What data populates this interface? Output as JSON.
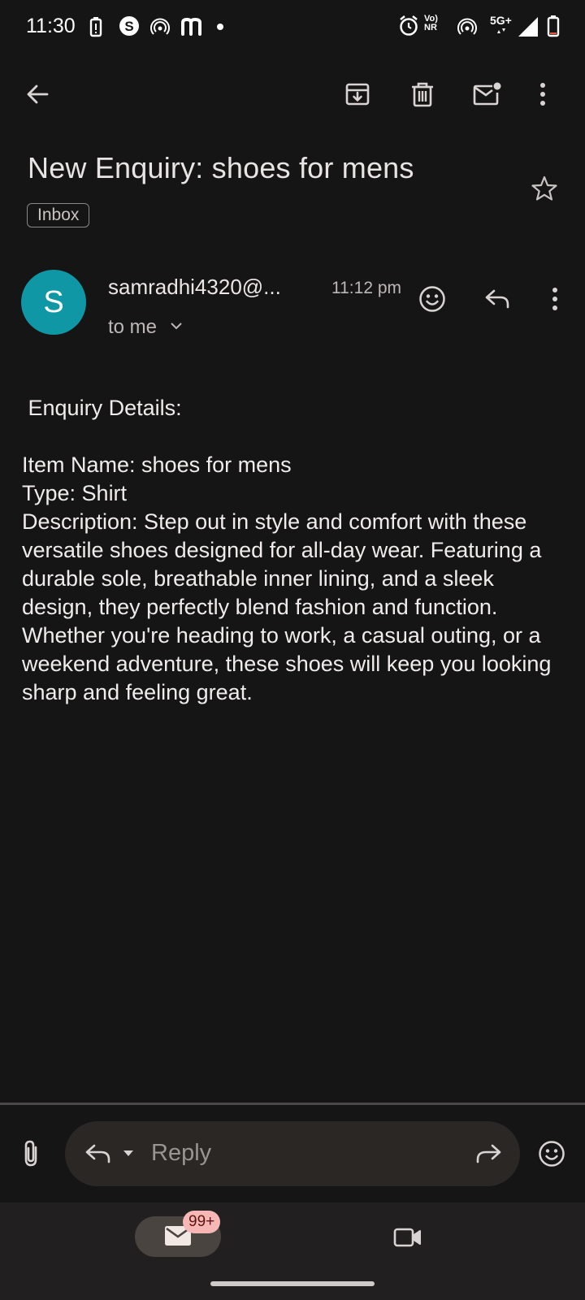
{
  "status_bar": {
    "time": "11:30",
    "left_icons": [
      "battery-saver-icon",
      "s-app-icon",
      "hotspot-icon",
      "m-app-icon",
      "dot-icon"
    ],
    "right_icons": [
      "alarm-icon",
      "vonr-icon",
      "hotspot-icon",
      "signal-icon",
      "battery-icon"
    ],
    "vo_label": "Vo",
    "nr_label": "NR",
    "network_label": "5G+"
  },
  "toolbar": {
    "back": "back-arrow-icon",
    "archive": "archive-icon",
    "delete": "delete-icon",
    "mark_unread": "mark-unread-icon",
    "more": "more-vert-icon"
  },
  "email": {
    "subject": "New Enquiry: shoes for mens",
    "label": "Inbox",
    "sender": {
      "initial": "S",
      "name": "samradhi4320@...",
      "time": "11:12 pm",
      "recipient": "to me"
    },
    "body": " Enquiry Details:\n\nItem Name: shoes for mens\nType: Shirt\nDescription: Step out in style and comfort with these versatile shoes designed for all-day wear. Featuring a durable sole, breathable inner lining, and a sleek design, they perfectly blend fashion and function. Whether you're heading to work, a casual outing, or a weekend adventure, these shoes will keep you looking sharp and feeling great."
  },
  "reply_bar": {
    "placeholder": "Reply"
  },
  "bottom_nav": {
    "mail_badge": "99+"
  },
  "colors": {
    "background": "#161515",
    "avatar": "#0f97a6",
    "badge": "#f7b8b5",
    "reply_bar": "#2b2724"
  }
}
